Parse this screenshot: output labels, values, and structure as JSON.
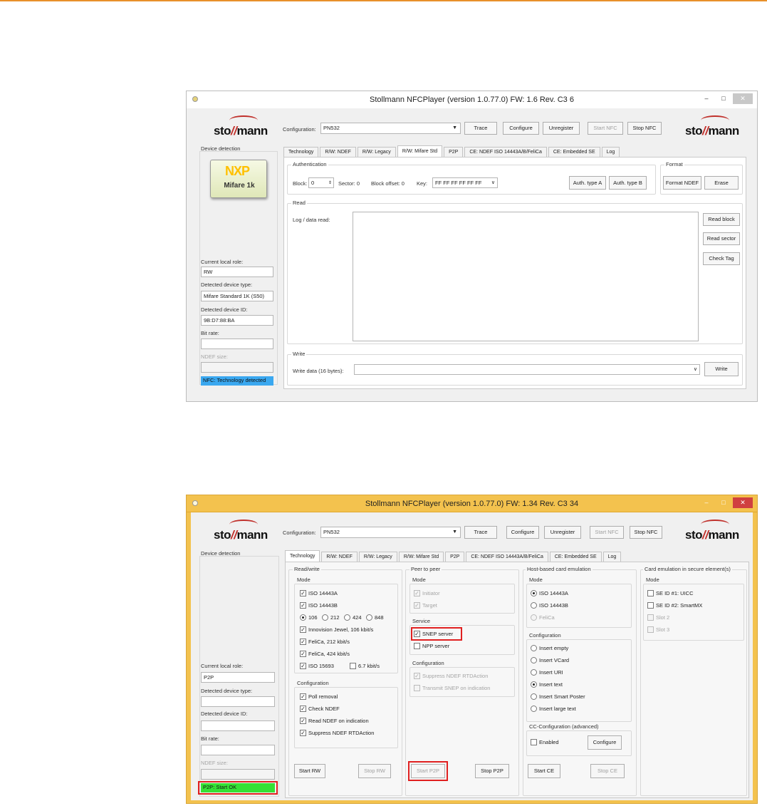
{
  "window1": {
    "title": "Stollmann NFCPlayer (version 1.0.77.0)   FW: 1.6 Rev. C3 6",
    "logo": {
      "left": "sto",
      "slash": "//",
      "right": "mann"
    },
    "config_label": "Configuration:",
    "config_value": "PN532",
    "buttons": {
      "trace": "Trace",
      "configure": "Configure",
      "unregister": "Unregister",
      "start_nfc": "Start NFC",
      "stop_nfc": "Stop NFC"
    },
    "device_detection": "Device detection",
    "nxp": {
      "logo": "NXP",
      "card": "Mifare 1k"
    },
    "tabs": [
      "Technology",
      "R/W: NDEF",
      "R/W: Legacy",
      "R/W: Mifare Std",
      "P2P",
      "CE: NDEF ISO 14443A/B/FeliCa",
      "CE: Embedded SE",
      "Log"
    ],
    "left": {
      "local_role_label": "Current local role:",
      "local_role": "RW",
      "device_type_label": "Detected device type:",
      "device_type": "Mifare Standard 1K (S50)",
      "device_id_label": "Detected device ID:",
      "device_id": "9B:D7:88:BA",
      "bit_rate_label": "Bit rate:",
      "bit_rate": "",
      "ndef_size_label": "NDEF size:",
      "status": "NFC: Technology detected"
    },
    "auth": {
      "title": "Authentication",
      "block_label": "Block:",
      "block_value": "0",
      "sector": "Sector: 0",
      "block_offset": "Block offset: 0",
      "key_label": "Key:",
      "key_value": "FF FF FF FF FF FF",
      "auth_a": "Auth. type A",
      "auth_b": "Auth. type B"
    },
    "format": {
      "title": "Format",
      "format_ndef": "Format NDEF",
      "erase": "Erase"
    },
    "read": {
      "title": "Read",
      "log_label": "Log / data read:",
      "read_block": "Read block",
      "read_sector": "Read sector",
      "check_tag": "Check Tag"
    },
    "write": {
      "title": "Write",
      "label": "Write data (16 bytes):",
      "button": "Write"
    }
  },
  "window2": {
    "title": "Stollmann NFCPlayer (version 1.0.77.0)   FW: 1.34 Rev. C3 34",
    "logo": {
      "left": "sto",
      "slash": "//",
      "right": "mann"
    },
    "config_label": "Configuration:",
    "config_value": "PN532",
    "buttons": {
      "trace": "Trace",
      "configure": "Configure",
      "unregister": "Unregister",
      "start_nfc": "Start NFC",
      "stop_nfc": "Stop NFC"
    },
    "device_detection": "Device detection",
    "tabs": [
      "Technology",
      "R/W: NDEF",
      "R/W: Legacy",
      "R/W: Mifare Std",
      "P2P",
      "CE: NDEF ISO 14443A/B/FeliCa",
      "CE: Embedded SE",
      "Log"
    ],
    "left": {
      "local_role_label": "Current local role:",
      "local_role": "P2P",
      "device_type_label": "Detected device type:",
      "device_type": "",
      "device_id_label": "Detected device ID:",
      "device_id": "",
      "bit_rate_label": "Bit rate:",
      "bit_rate": "",
      "ndef_size_label": "NDEF size:",
      "status": "P2P: Start OK"
    },
    "rw": {
      "title": "Read/write",
      "mode_title": "Mode",
      "iso14443a": "ISO 14443A",
      "iso14443b": "ISO 14443B",
      "r106": "106",
      "r212": "212",
      "r424": "424",
      "r848": "848",
      "jewel": "Innovision Jewel, 106 kbit/s",
      "felica212": "FeliCa, 212 kbit/s",
      "felica424": "FeliCa, 424 kbit/s",
      "iso15693": "ISO 15693",
      "k67": "6.7 kbit/s",
      "config_title": "Configuration",
      "poll_removal": "Poll removal",
      "check_ndef": "Check NDEF",
      "read_ndef": "Read NDEF on indication",
      "suppress": "Suppress NDEF RTDAction",
      "start": "Start RW",
      "stop": "Stop RW"
    },
    "p2p": {
      "title": "Peer to peer",
      "mode_title": "Mode",
      "initiator": "Initiator",
      "target": "Target",
      "service_title": "Service",
      "snep": "SNEP server",
      "npp": "NPP server",
      "config_title": "Configuration",
      "suppress": "Suppress NDEF RTDAction",
      "transmit": "Transmit SNEP on indication",
      "start": "Start P2P",
      "stop": "Stop P2P"
    },
    "hce": {
      "title": "Host-based card emulation",
      "mode_title": "Mode",
      "iso14443a": "ISO 14443A",
      "iso14443b": "ISO 14443B",
      "felica": "FeliCa",
      "config_title": "Configuration",
      "insert_empty": "Insert empty",
      "insert_vcard": "Insert VCard",
      "insert_uri": "Insert URI",
      "insert_text": "Insert text",
      "insert_poster": "Insert Smart Poster",
      "insert_large": "Insert large text",
      "cc_title": "CC-Configuration (advanced)",
      "enabled": "Enabled",
      "configure": "Configure",
      "start": "Start CE",
      "stop": "Stop CE"
    },
    "se": {
      "title": "Card emulation in secure element(s)",
      "mode_title": "Mode",
      "se1": "SE ID #1: UICC",
      "se2": "SE ID #2: SmartMX",
      "slot2": "Slot 2",
      "slot3": "Slot 3"
    }
  },
  "colors": {
    "accent_orange": "#e8902a",
    "status_blue": "#3aa8f0",
    "status_green": "#35e035",
    "highlight_red": "#e02020",
    "logo_red": "#c0302b"
  }
}
